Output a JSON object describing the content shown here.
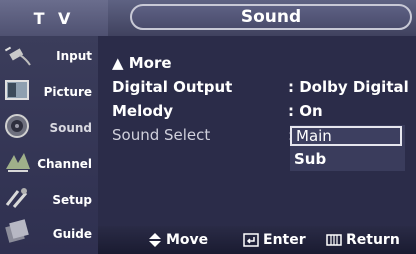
{
  "header": {
    "tv_label": "T V",
    "title": "Sound"
  },
  "sidebar": {
    "items": [
      {
        "label": "Input",
        "icon": "input-plug-icon"
      },
      {
        "label": "Picture",
        "icon": "picture-icon"
      },
      {
        "label": "Sound",
        "icon": "speaker-icon",
        "active": true
      },
      {
        "label": "Channel",
        "icon": "channel-icon"
      },
      {
        "label": "Setup",
        "icon": "setup-icon"
      },
      {
        "label": "Guide",
        "icon": "guide-icon"
      }
    ]
  },
  "menu": {
    "more_label": "▲ More",
    "rows": [
      {
        "label": "Digital Output",
        "value": ": Dolby Digital"
      },
      {
        "label": "Melody",
        "value": ": On"
      },
      {
        "label": "Sound Select",
        "value": ":"
      }
    ],
    "dropdown_options": [
      "Main",
      "Sub"
    ],
    "dropdown_selected": "Main"
  },
  "footer": {
    "move": "Move",
    "enter": "Enter",
    "return": "Return"
  },
  "colors": {
    "background": "#2b2c49",
    "accent": "#5e6283",
    "text": "#ffffff"
  }
}
